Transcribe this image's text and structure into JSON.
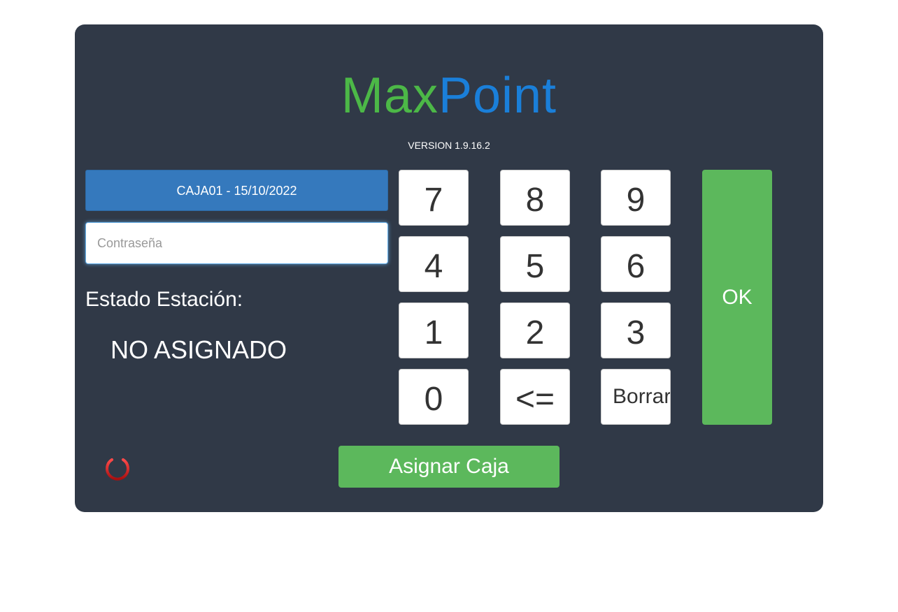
{
  "logo": {
    "part1": "Max",
    "part2": "Point",
    "color1": "#4cb847",
    "color2": "#1a7fd9"
  },
  "version": "VERSION 1.9.16.2",
  "caja_button": "CAJA01 - 15/10/2022",
  "password": {
    "value": "",
    "placeholder": "Contraseña"
  },
  "estado": {
    "label": "Estado Estación:",
    "value": "NO ASIGNADO"
  },
  "keypad": {
    "keys": [
      "7",
      "8",
      "9",
      "4",
      "5",
      "6",
      "1",
      "2",
      "3",
      "0",
      "<=",
      "Borrar"
    ]
  },
  "ok_button": "OK",
  "assign_button": "Asignar Caja",
  "icons": {
    "power": "power-icon"
  },
  "colors": {
    "panel": "#303947",
    "primary": "#3579bd",
    "success": "#5cb85c",
    "power": "#d42a2a"
  }
}
